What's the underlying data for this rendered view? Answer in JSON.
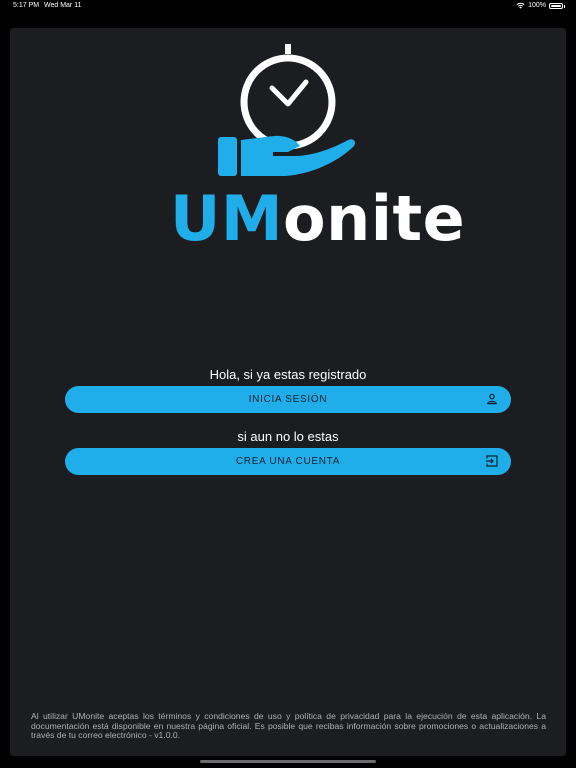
{
  "status_bar": {
    "time": "5:17 PM",
    "date": "Wed Mar 11",
    "battery": "100%"
  },
  "brand": {
    "accent": "UM",
    "rest": "onite",
    "accent_color": "#20aeea"
  },
  "login": {
    "prompt": "Hola, si ya estas registrado",
    "button_label": "INICIA SESIÓN",
    "icon": "person-icon"
  },
  "register": {
    "prompt": "si aun no lo estas",
    "button_label": "CREA UNA CUENTA",
    "icon": "sign-in-icon"
  },
  "footer": {
    "legal_text": "Al utilizar UMonite aceptas los términos y condiciones de uso y política de privacidad para la ejecución de esta aplicación. La documentación está disponible en nuestra página oficial. Es posible que recibas información sobre promociones o actualizaciones a través de tu correo electrónico - v1.0.0."
  },
  "colors": {
    "background": "#1c1d20",
    "button": "#20aeea",
    "button_text": "#0d2230"
  }
}
